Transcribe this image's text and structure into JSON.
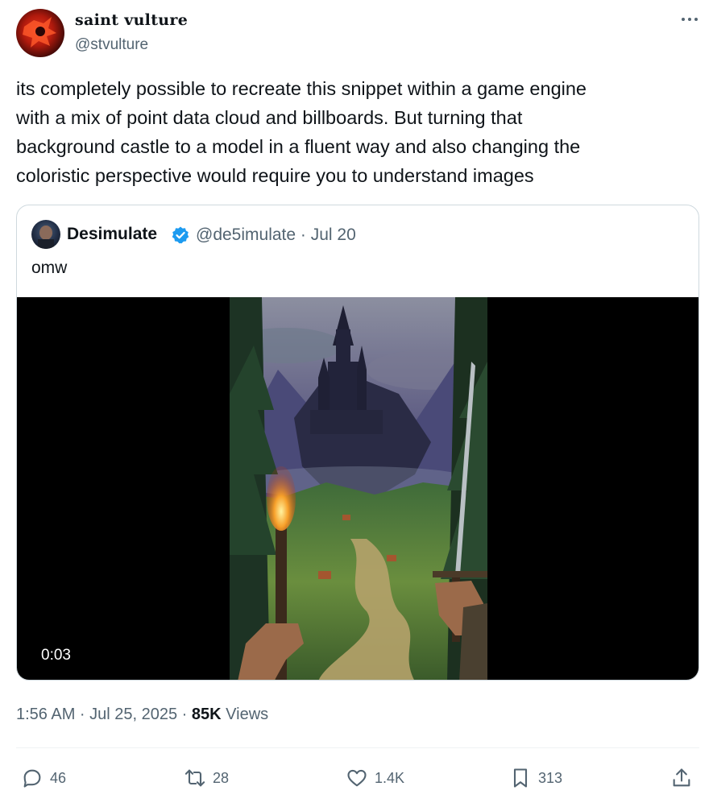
{
  "author": {
    "display_name": "saint vulture",
    "handle": "@stvulture"
  },
  "tweet": {
    "text": "its completely possible to recreate this snippet within a game engine\nwith a mix of point data cloud and billboards. But turning that\nbackground castle to a model in a fluent way and also changing the\ncoloristic perspective would require you to understand images"
  },
  "quoted": {
    "display_name": "Desimulate",
    "handle_date": "@de5imulate · Jul 20",
    "text": "omw",
    "video_duration": "0:03",
    "verified_color": "#1d9bf0"
  },
  "meta": {
    "time_date": "1:56 AM · Jul 25, 2025 · ",
    "views_count": "85K",
    "views_label": "Views"
  },
  "actions": {
    "replies": "46",
    "reposts": "28",
    "likes": "1.4K",
    "bookmarks": "313"
  },
  "icons": [
    "more-icon",
    "verified-icon",
    "reply-icon",
    "repost-icon",
    "like-icon",
    "bookmark-icon",
    "share-icon"
  ]
}
